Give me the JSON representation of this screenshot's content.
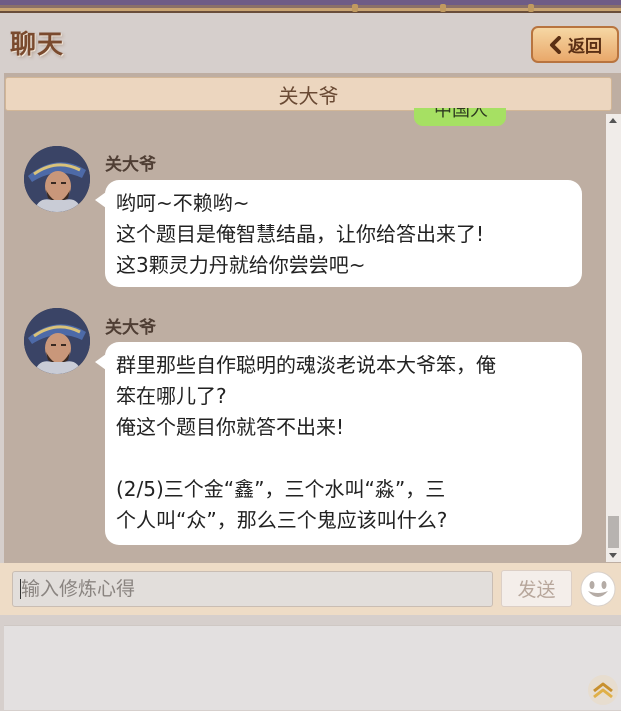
{
  "header": {
    "title": "聊天",
    "back_label": "返回"
  },
  "chat": {
    "contact_name": "关大爷",
    "partial_bubble_text": "中国人",
    "messages": [
      {
        "sender": "关大爷",
        "lines": [
          "哟呵~不赖哟~",
          "这个题目是俺智慧结晶，让你给答出来了!",
          "这3颗灵力丹就给你尝尝吧~"
        ]
      },
      {
        "sender": "关大爷",
        "lines": [
          "群里那些自作聪明的魂淡老说本大爷笨，俺",
          "笨在哪儿了?",
          "俺这个题目你就答不出来!",
          "",
          "(2/5)三个金“鑫”，三个水叫“淼”，三",
          "个人叫“众”，那么三个鬼应该叫什么?"
        ]
      }
    ]
  },
  "composer": {
    "placeholder": "输入修炼心得",
    "value": "",
    "send_label": "发送"
  },
  "icons": {
    "back": "chevron-left-icon",
    "emoji": "smiley-icon",
    "scroll_top": "double-chevron-up-icon",
    "avatar": "character-portrait"
  },
  "colors": {
    "chat_bg": "#beaea2",
    "bubble_in": "#ffffff",
    "bubble_out": "#a6e063",
    "accent": "#e9a86a",
    "title": "#7a4a2e"
  }
}
